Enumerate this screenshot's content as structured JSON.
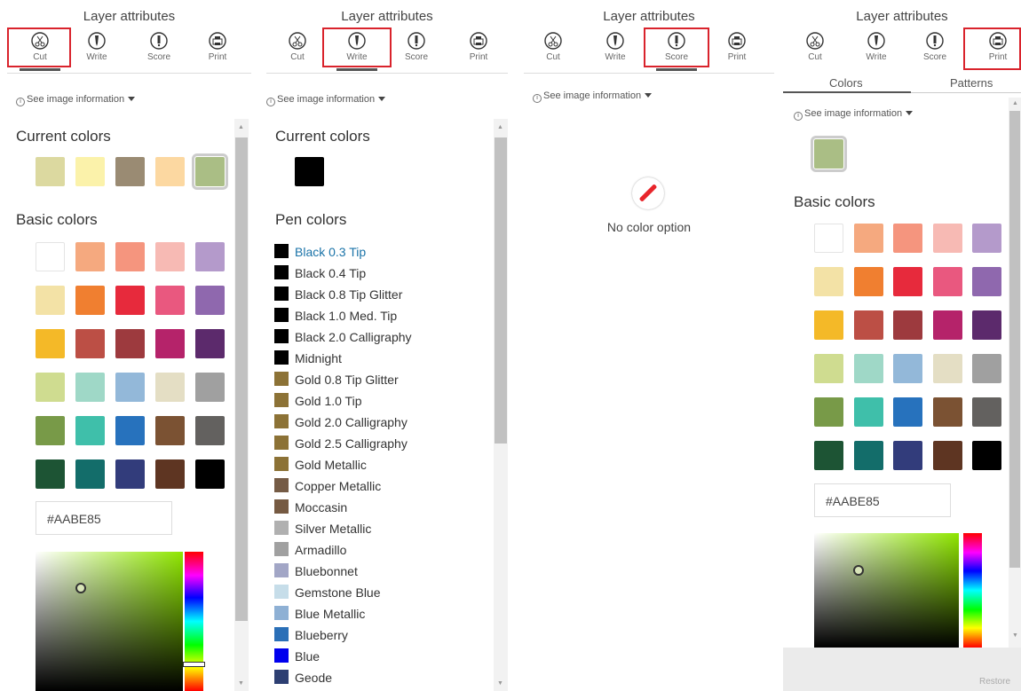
{
  "title": "Layer attributes",
  "tabs": {
    "cut": "Cut",
    "write": "Write",
    "score": "Score",
    "print": "Print"
  },
  "see_info": "See image information",
  "current_colors": "Current colors",
  "basic_colors": "Basic colors",
  "pen_colors_heading": "Pen colors",
  "hex_value": "#AABE85",
  "no_color": "No color option",
  "subtabs": {
    "colors": "Colors",
    "patterns": "Patterns"
  },
  "restore": "Restore",
  "current_colors_cut": [
    "#dcd9a0",
    "#fbf2aa",
    "#9a8b73",
    "#fcd8a1",
    "#aabe85"
  ],
  "current_colors_write": [
    "#000000"
  ],
  "current_colors_print": [
    "#aabe85"
  ],
  "basic_palette": [
    [
      "#ffffff",
      "#f5a97f",
      "#f5957e",
      "#f7bab4",
      "#b49acb"
    ],
    [
      "#f3e2a6",
      "#f07f30",
      "#e72a3c",
      "#e9587f",
      "#8f68ae"
    ],
    [
      "#f4b928",
      "#bc4f45",
      "#9d3a3e",
      "#b5236a",
      "#5c2a6c"
    ],
    [
      "#cfdc90",
      "#9fd8c7",
      "#93b8d9",
      "#e4dec4",
      "#a0a0a0"
    ],
    [
      "#789a48",
      "#3fbfaa",
      "#2772bd",
      "#7b5233",
      "#63615f"
    ],
    [
      "#1d5434",
      "#136d6a",
      "#323c7b",
      "#5e3522",
      "#000000"
    ]
  ],
  "pen_colors": [
    {
      "name": "Black 0.3 Tip",
      "color": "#000000"
    },
    {
      "name": "Black 0.4 Tip",
      "color": "#000000"
    },
    {
      "name": "Black 0.8 Tip Glitter",
      "color": "#000000"
    },
    {
      "name": "Black 1.0 Med. Tip",
      "color": "#000000"
    },
    {
      "name": "Black 2.0 Calligraphy",
      "color": "#000000"
    },
    {
      "name": "Midnight",
      "color": "#000000"
    },
    {
      "name": "Gold 0.8 Tip Glitter",
      "color": "#8c7236"
    },
    {
      "name": "Gold 1.0 Tip",
      "color": "#8c7236"
    },
    {
      "name": "Gold 2.0 Calligraphy",
      "color": "#8c7236"
    },
    {
      "name": "Gold 2.5 Calligraphy",
      "color": "#8c7236"
    },
    {
      "name": "Gold Metallic",
      "color": "#8c7236"
    },
    {
      "name": "Copper Metallic",
      "color": "#755b45"
    },
    {
      "name": "Moccasin",
      "color": "#765a42"
    },
    {
      "name": "Silver Metallic",
      "color": "#b0b0b0"
    },
    {
      "name": "Armadillo",
      "color": "#a0a0a0"
    },
    {
      "name": "Bluebonnet",
      "color": "#a2a6c6"
    },
    {
      "name": "Gemstone Blue",
      "color": "#c6dde9"
    },
    {
      "name": "Blue Metallic",
      "color": "#8eb0d4"
    },
    {
      "name": "Blueberry",
      "color": "#2a6fb7"
    },
    {
      "name": "Blue",
      "color": "#0000ee"
    },
    {
      "name": "Geode",
      "color": "#2d3f72"
    }
  ],
  "accent_color": "#d9232c"
}
